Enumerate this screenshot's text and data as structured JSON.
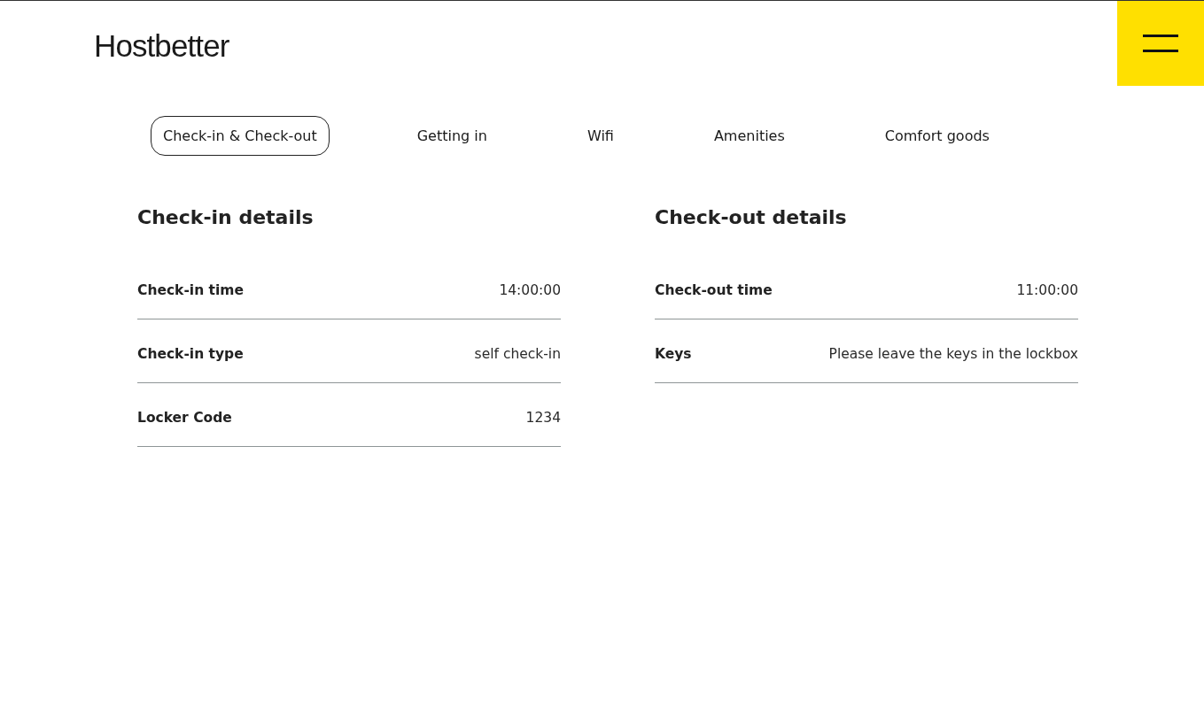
{
  "header": {
    "logo": "Hostbetter"
  },
  "tabs": [
    {
      "label": "Check-in & Check-out",
      "selected": true
    },
    {
      "label": "Getting in",
      "selected": false
    },
    {
      "label": "Wifi",
      "selected": false
    },
    {
      "label": "Amenities",
      "selected": false
    },
    {
      "label": "Comfort goods",
      "selected": false
    }
  ],
  "sections": [
    {
      "title": "Check-in details",
      "rows": [
        {
          "label": "Check-in time",
          "value": "14:00:00"
        },
        {
          "label": "Check-in type",
          "value": "self check-in"
        },
        {
          "label": "Locker Code",
          "value": "1234"
        }
      ]
    },
    {
      "title": "Check-out details",
      "rows": [
        {
          "label": "Check-out time",
          "value": "11:00:00"
        },
        {
          "label": "Keys",
          "value": "Please leave the keys in the lockbox"
        }
      ]
    }
  ]
}
